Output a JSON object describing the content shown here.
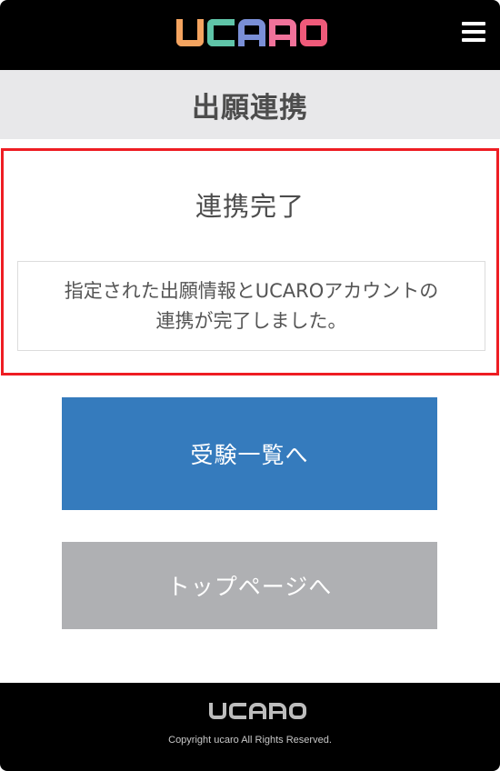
{
  "header": {
    "logo_text": "UCARO",
    "logo_colors": [
      "#f4a460",
      "#5fc4a8",
      "#7a8fd6",
      "#f0729a",
      "#ef5a7a"
    ],
    "menu_icon": "hamburger-menu-icon"
  },
  "title_bar": {
    "title": "出願連携"
  },
  "panel": {
    "heading": "連携完了",
    "message_line1": "指定された出願情報とUCAROアカウントの",
    "message_line2": "連携が完了しました。",
    "border_color": "#ee1d23"
  },
  "buttons": {
    "exam_list": "受験一覧へ",
    "to_top": "トップページへ",
    "exam_list_color": "#357bbd",
    "to_top_color": "#afb0b3"
  },
  "footer": {
    "logo_text": "UCARO",
    "copyright": "Copyright ucaro All Rights Reserved."
  }
}
